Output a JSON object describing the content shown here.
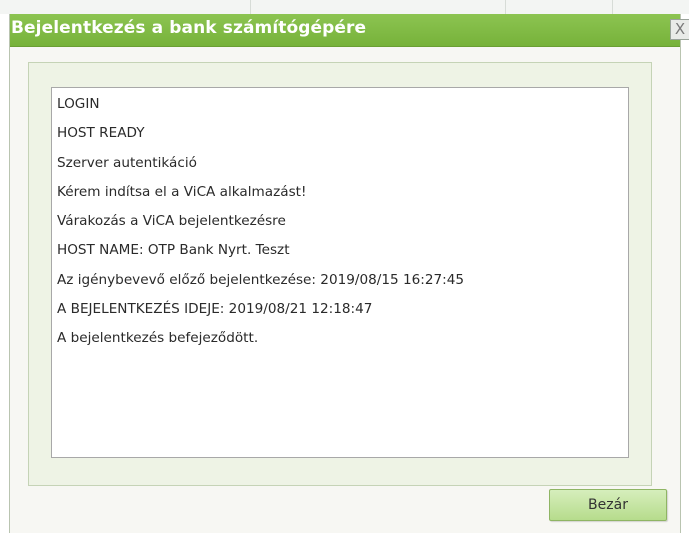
{
  "window": {
    "title": "Bejelentkezés a bank számítógépére",
    "close_glyph": "X"
  },
  "log": {
    "lines": [
      "LOGIN",
      "HOST READY",
      "Szerver autentikáció",
      "Kérem indítsa el a ViCA alkalmazást!",
      "Várakozás a ViCA bejelentkezésre",
      "HOST NAME: OTP Bank Nyrt. Teszt",
      "Az igénybevevő előző bejelentkezése: 2019/08/15 16:27:45",
      "A BEJELENTKEZÉS IDEJE: 2019/08/21 12:18:47",
      "A bejelentkezés befejeződött."
    ]
  },
  "footer": {
    "close_label": "Bezár"
  },
  "colors": {
    "titlebar": "#80bb45",
    "button": "#c6e5a4",
    "panel": "#eef3e5"
  }
}
